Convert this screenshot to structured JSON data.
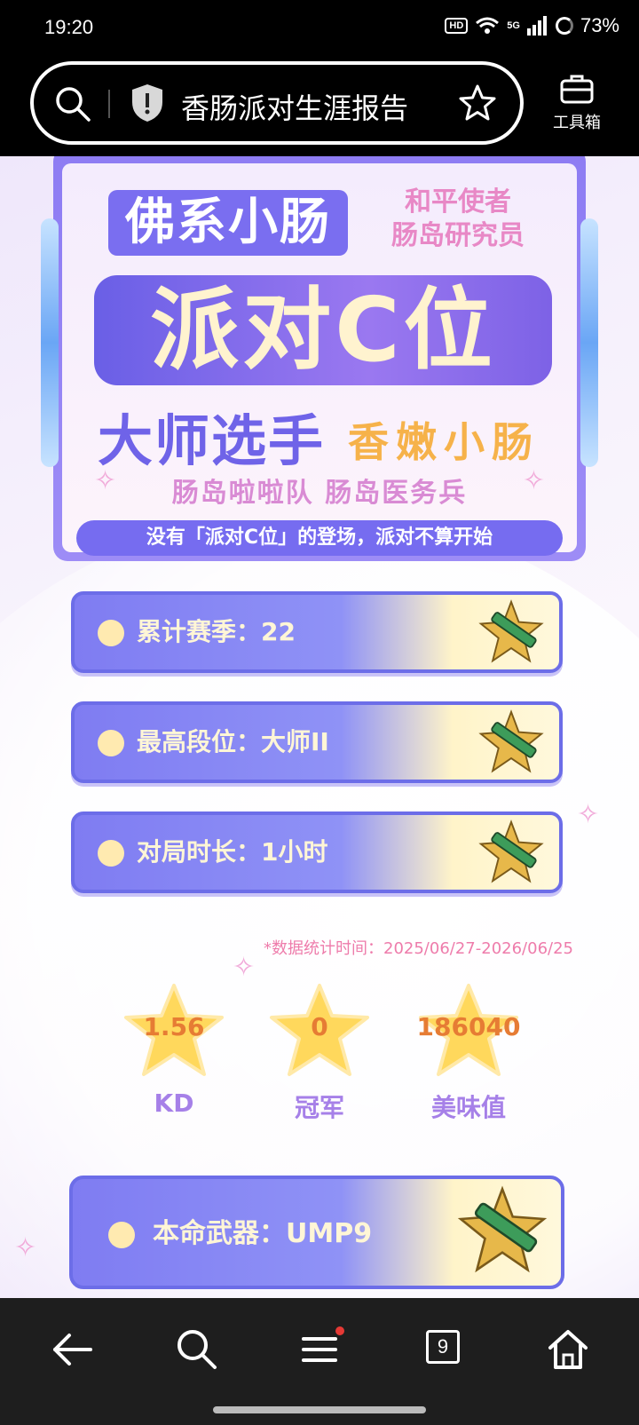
{
  "status": {
    "time": "19:20",
    "hd": "HD",
    "signal": "5G",
    "battery": "73%"
  },
  "browser": {
    "title": "香肠派对生涯报告",
    "toolbox_label": "工具箱"
  },
  "banner": {
    "nickname": "佛系小肠",
    "title_lines": [
      "和平使者",
      "肠岛研究员"
    ],
    "main_title": "派对C位",
    "rank_title": "大师选手",
    "tag": "香嫩小肠",
    "roles": "肠岛啦啦队 肠岛医务兵",
    "slogan": "没有「派对C位」的登场，派对不算开始"
  },
  "stats": [
    {
      "label": "累计赛季：22"
    },
    {
      "label": "最高段位：大师II"
    },
    {
      "label": "对局时长：1小时"
    }
  ],
  "date_note": "*数据统计时间：2025/06/27-2026/06/25",
  "star_stats": [
    {
      "value": "1.56",
      "label": "KD"
    },
    {
      "value": "0",
      "label": "冠军"
    },
    {
      "value": "186040",
      "label": "美味值"
    }
  ],
  "weapon": {
    "label": "本命武器：UMP9"
  },
  "nav": {
    "tab_count": "9"
  }
}
